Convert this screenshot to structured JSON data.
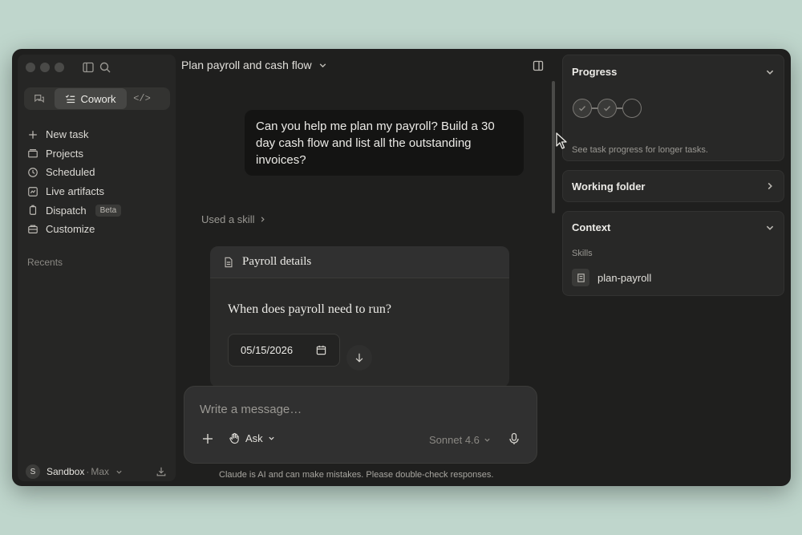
{
  "sidebar": {
    "modes": {
      "cowork_label": "Cowork"
    },
    "nav": [
      {
        "label": "New task",
        "icon": "plus-icon"
      },
      {
        "label": "Projects",
        "icon": "projects-icon"
      },
      {
        "label": "Scheduled",
        "icon": "clock-icon"
      },
      {
        "label": "Live artifacts",
        "icon": "artifacts-icon"
      },
      {
        "label": "Dispatch",
        "icon": "dispatch-icon",
        "badge": "Beta"
      },
      {
        "label": "Customize",
        "icon": "customize-icon"
      }
    ],
    "recents_label": "Recents",
    "account": {
      "initial": "S",
      "name": "Sandbox",
      "separator": "·",
      "plan": "Max"
    }
  },
  "main": {
    "title": "Plan payroll and cash flow",
    "user_message": "Can you help me plan my payroll? Build a 30 day cash flow and list all the outstanding invoices?",
    "skill_link": "Used a skill",
    "card": {
      "title": "Payroll details",
      "question": "When does payroll need to run?",
      "date_value": "05/15/2026"
    },
    "composer": {
      "placeholder": "Write a message…",
      "mode": "Ask",
      "model": "Sonnet 4.6"
    },
    "disclaimer": "Claude is AI and can make mistakes. Please double-check responses."
  },
  "right_panel": {
    "progress": {
      "title": "Progress",
      "steps_completed": 2,
      "steps_total": 3,
      "note": "See task progress for longer tasks."
    },
    "working_folder": {
      "title": "Working folder"
    },
    "context": {
      "title": "Context",
      "skills_label": "Skills",
      "skill_name": "plan-payroll"
    }
  },
  "colors": {
    "window_bg": "#1f1f1e",
    "page_bg": "#bfd6cc",
    "panel_bg": "#282827"
  }
}
